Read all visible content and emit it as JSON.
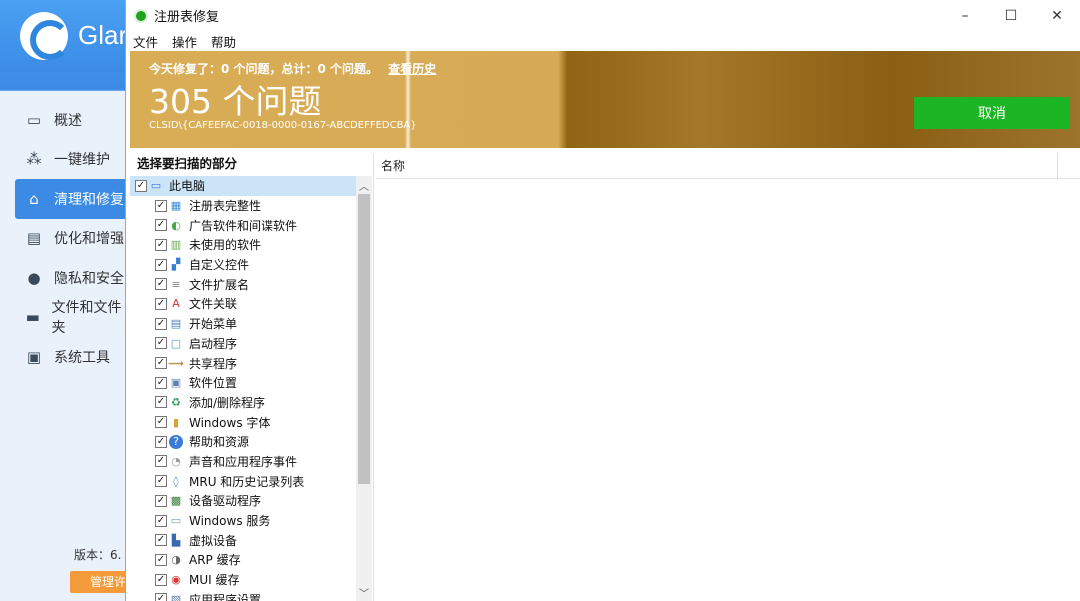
{
  "background_app": {
    "brand": "Glar",
    "nav": [
      {
        "icon": "monitor-icon",
        "label": "概述"
      },
      {
        "icon": "sparkle-icon",
        "label": "一键维护"
      },
      {
        "icon": "broom-icon",
        "label": "清理和修复"
      },
      {
        "icon": "shield-doc-icon",
        "label": "优化和增强"
      },
      {
        "icon": "privacy-icon",
        "label": "隐私和安全"
      },
      {
        "icon": "folder-icon",
        "label": "文件和文件夹"
      },
      {
        "icon": "toolbox-icon",
        "label": "系统工具"
      }
    ],
    "version_label": "版本：6.",
    "manage_label": "管理许"
  },
  "window": {
    "title": "注册表修复",
    "controls": {
      "minimize": "–",
      "maximize": "☐",
      "close": "✕"
    },
    "menu": [
      "文件",
      "操作",
      "帮助"
    ]
  },
  "banner": {
    "summary": "今天修复了：0 个问题，总计：0 个问题。",
    "history_link": "查看历史",
    "count_text": "305 个问题",
    "scan_path": "CLSID\\{CAFEEFAC-0018-0000-0167-ABCDEFFEDCBA}",
    "cancel_label": "取消",
    "cancel_color": "#1cb525"
  },
  "left_panel": {
    "header": "选择要扫描的部分",
    "root": {
      "label": "此电脑",
      "checked": true,
      "icon": "computer-icon"
    },
    "items": [
      {
        "label": "注册表完整性",
        "icon": "registry-icon",
        "checked": true
      },
      {
        "label": "广告软件和间谍软件",
        "icon": "spyware-icon",
        "checked": true
      },
      {
        "label": "未使用的软件",
        "icon": "unused-software-icon",
        "checked": true
      },
      {
        "label": "自定义控件",
        "icon": "custom-control-icon",
        "checked": true
      },
      {
        "label": "文件扩展名",
        "icon": "file-extension-icon",
        "checked": true
      },
      {
        "label": "文件关联",
        "icon": "file-association-icon",
        "checked": true
      },
      {
        "label": "开始菜单",
        "icon": "start-menu-icon",
        "checked": true
      },
      {
        "label": "启动程序",
        "icon": "startup-icon",
        "checked": true
      },
      {
        "label": "共享程序",
        "icon": "shared-program-icon",
        "checked": true
      },
      {
        "label": "软件位置",
        "icon": "software-location-icon",
        "checked": true
      },
      {
        "label": "添加/删除程序",
        "icon": "add-remove-icon",
        "checked": true
      },
      {
        "label": "Windows 字体",
        "icon": "font-icon",
        "checked": true
      },
      {
        "label": "帮助和资源",
        "icon": "help-icon",
        "checked": true
      },
      {
        "label": "声音和应用程序事件",
        "icon": "sound-icon",
        "checked": true
      },
      {
        "label": "MRU 和历史记录列表",
        "icon": "history-icon",
        "checked": true
      },
      {
        "label": "设备驱动程序",
        "icon": "driver-icon",
        "checked": true
      },
      {
        "label": "Windows 服务",
        "icon": "service-icon",
        "checked": true
      },
      {
        "label": "虚拟设备",
        "icon": "virtual-device-icon",
        "checked": true
      },
      {
        "label": "ARP 缓存",
        "icon": "arp-icon",
        "checked": true
      },
      {
        "label": "MUI 缓存",
        "icon": "mui-icon",
        "checked": true
      },
      {
        "label": "应用程序设置",
        "icon": "app-settings-icon",
        "checked": true
      }
    ]
  },
  "results": {
    "column_name": "名称"
  }
}
